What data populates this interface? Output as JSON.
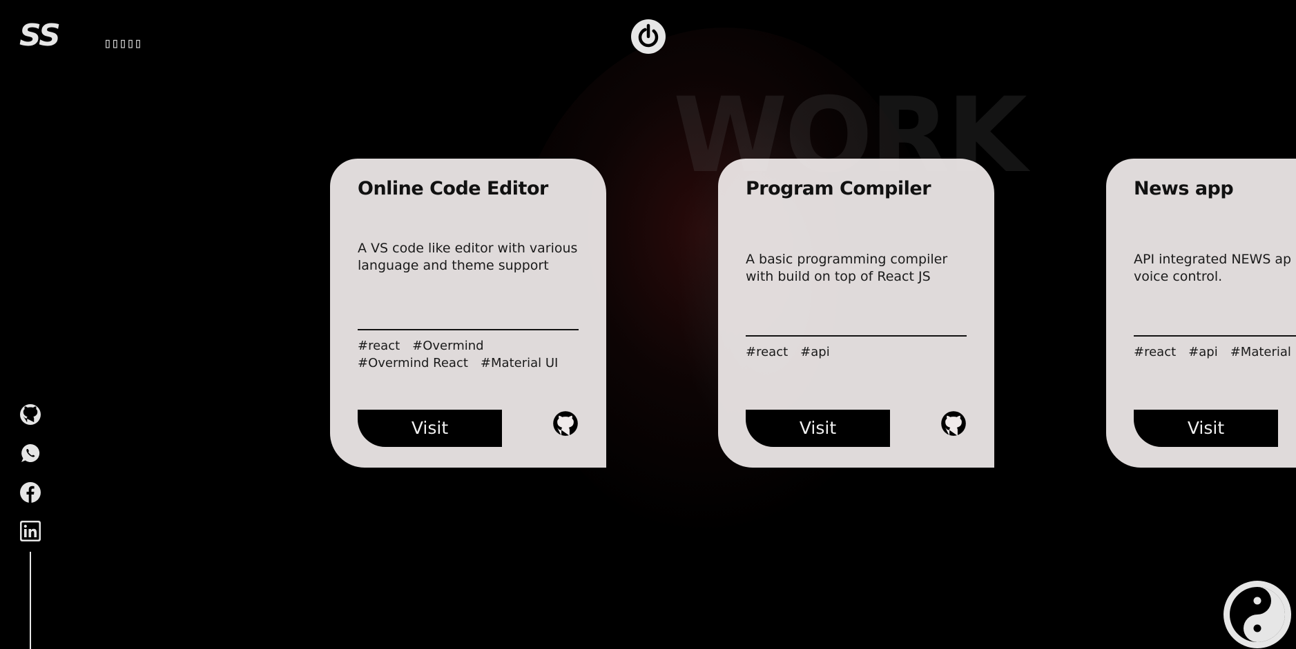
{
  "header": {
    "logo_text": "SS",
    "lang_glyphs": "▯▯▯▯▯",
    "power_icon": "power-icon"
  },
  "watermark": "WORK",
  "social_links": [
    {
      "icon": "github-icon"
    },
    {
      "icon": "whatsapp-icon"
    },
    {
      "icon": "facebook-icon"
    },
    {
      "icon": "linkedin-icon"
    }
  ],
  "projects": [
    {
      "title": "Online Code Editor",
      "description": "A VS code like editor with various language and theme support",
      "tags": [
        "#react",
        "#Overmind",
        "#Overmind React",
        "#Material UI"
      ],
      "button_label": "Visit",
      "repo_icon": "github-icon"
    },
    {
      "title": "Program Compiler",
      "description": "A basic programming compiler with build on top of React JS",
      "tags": [
        "#react",
        "#api"
      ],
      "button_label": "Visit",
      "repo_icon": "github-icon"
    },
    {
      "title": "News app",
      "description": "API integrated NEWS ap voice control.",
      "tags": [
        "#react",
        "#api",
        "#Material U"
      ],
      "button_label": "Visit",
      "repo_icon": "github-icon"
    }
  ],
  "theme_toggle": {
    "icon": "yin-yang-icon"
  },
  "colors": {
    "background": "#000000",
    "card": "#f0ebeb",
    "text": "#111111",
    "icon": "#e6e6e6"
  }
}
